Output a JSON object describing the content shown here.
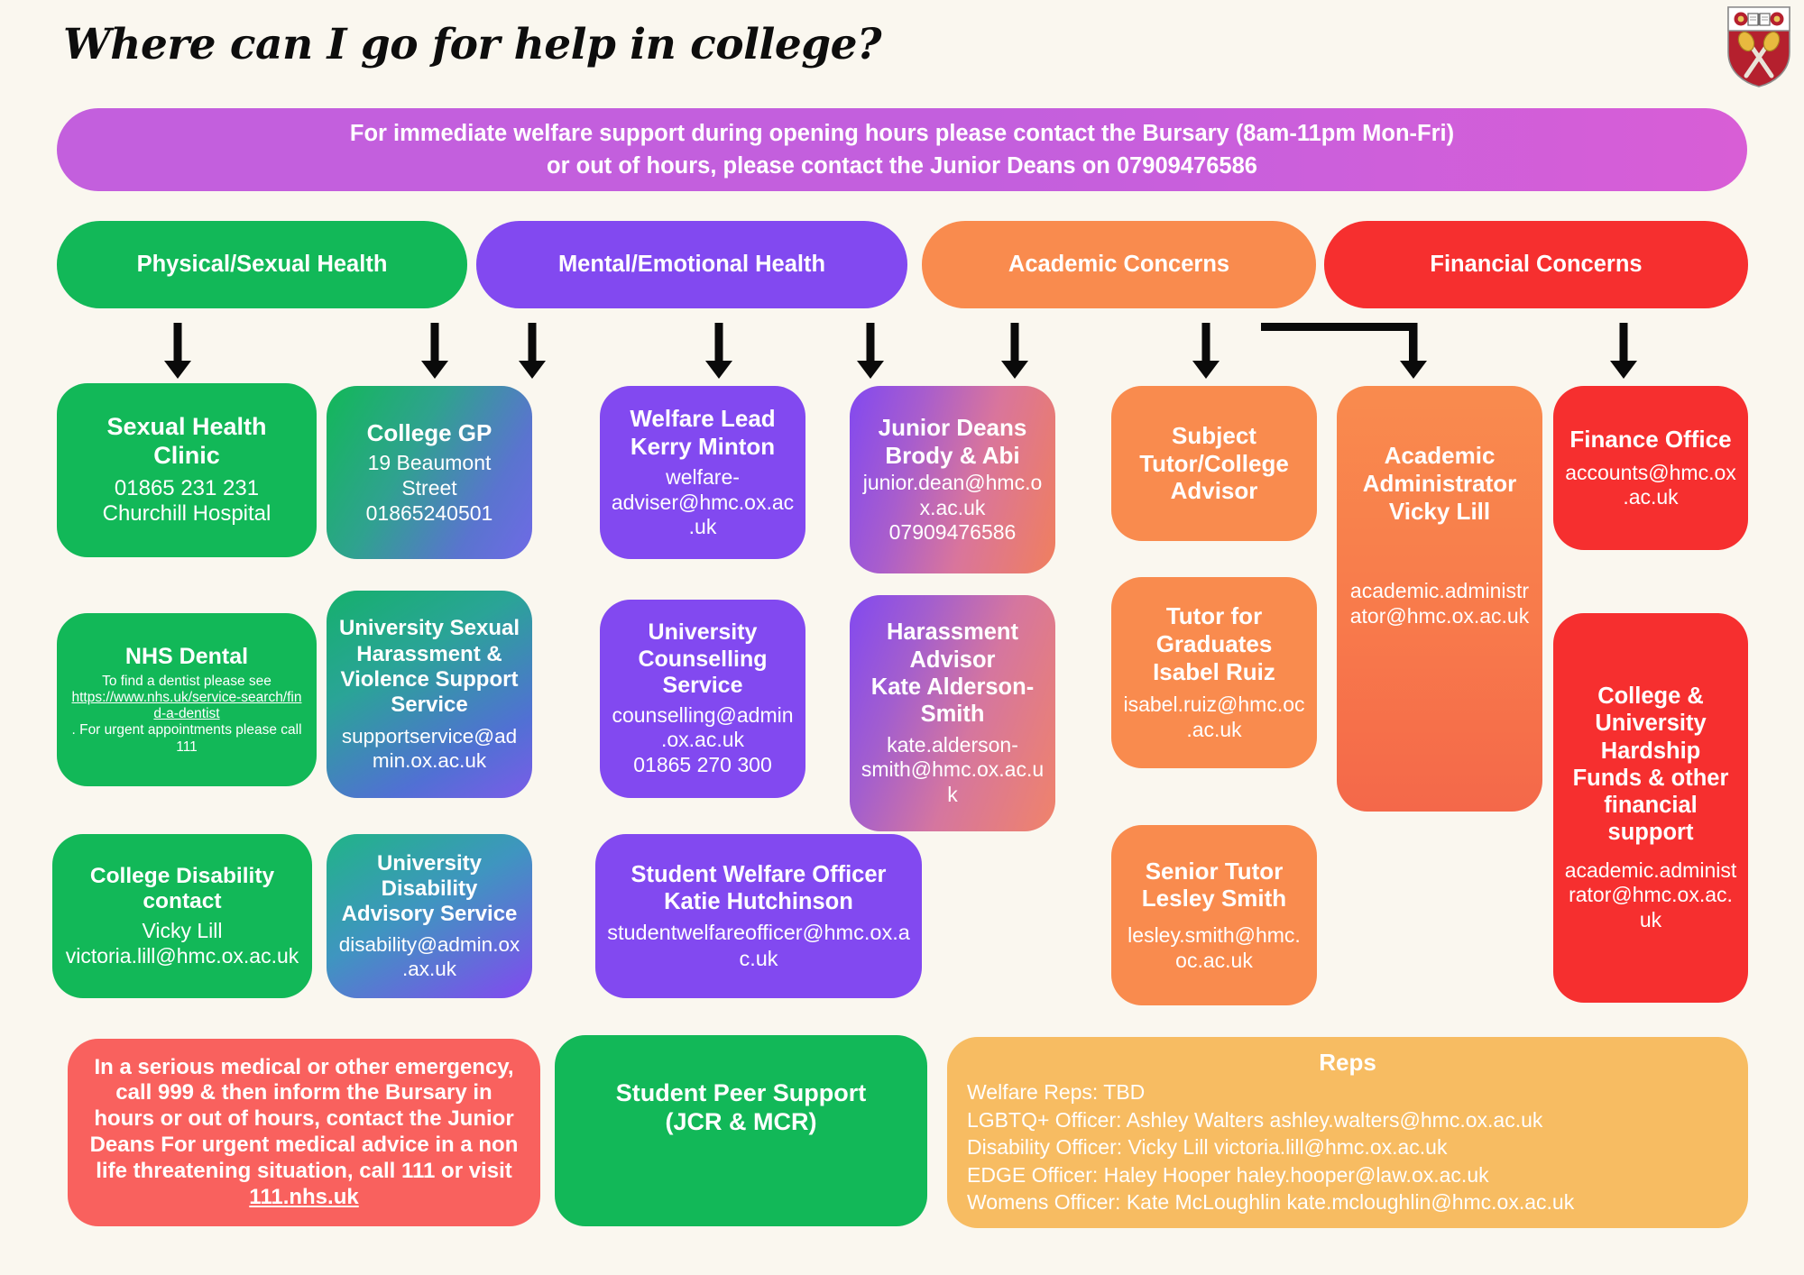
{
  "page": {
    "title": "Where can I go for help in college?",
    "background_color": "#faf7ef"
  },
  "crest": {
    "name": "college-coat-of-arms",
    "field_color": "#b5202e",
    "chief_color": "#ffffff",
    "charges": [
      "rose",
      "open-book",
      "rose",
      "crossed-maces"
    ]
  },
  "banner": {
    "line1": "For immediate welfare support during opening hours please contact the Bursary (8am-11pm Mon-Fri)",
    "line2": "or out of hours, please contact the Junior Deans on 07909476586",
    "color": "#c35fdd"
  },
  "categories": [
    {
      "label": "Physical/Sexual Health",
      "color": "#12b858"
    },
    {
      "label": "Mental/Emotional Health",
      "color": "#8249f0"
    },
    {
      "label": "Academic Concerns",
      "color": "#f98b4e"
    },
    {
      "label": "Financial Concerns",
      "color": "#f62f2f"
    }
  ],
  "cards": {
    "sexual_health_clinic": {
      "heading": "Sexual Health\nClinic",
      "body": "01865 231 231\nChurchill Hospital",
      "color": "#12b858"
    },
    "nhs_dental": {
      "heading": "NHS Dental",
      "body_pre": "To find a dentist please see",
      "link": "https://www.nhs.uk/service-search/find-a-dentist",
      "body_post": ". For urgent appointments please call 111",
      "color": "#12b858"
    },
    "college_disability": {
      "heading": "College Disability\ncontact",
      "body": "Vicky Lill\nvictoria.lill@hmc.ox.ac.uk",
      "color": "#12b858"
    },
    "college_gp": {
      "heading": "College GP",
      "body": "19 Beaumont Street\n01865240501",
      "color_from": "#12b858",
      "color_to": "#6f6ae6"
    },
    "university_sexual_harassment": {
      "heading": "University Sexual Harassment & Violence Support Service",
      "body": "supportservice@admin.ox.ac.uk",
      "color_from": "#15b06c",
      "color_to": "#7a5ce8"
    },
    "university_disability": {
      "heading": "University Disability Advisory Service",
      "body": "disability@admin.ox.ax.uk",
      "color_from": "#20b487",
      "color_to": "#8249f0"
    },
    "welfare_lead": {
      "heading": "Welfare Lead\nKerry Minton",
      "body": "welfare-adviser@hmc.ox.ac.uk",
      "color": "#8249f0"
    },
    "university_counselling": {
      "heading": "University Counselling Service",
      "body": "counselling@admin.ox.ac.uk\n01865 270 300",
      "color": "#8249f0"
    },
    "student_welfare_officer": {
      "heading": "Student Welfare Officer\nKatie Hutchinson",
      "body": "studentwelfareofficer@hmc.ox.ac.uk",
      "color": "#8249f0"
    },
    "junior_deans": {
      "heading": "Junior Deans\nBrody & Abi",
      "body": "junior.dean@hmc.ox.ac.uk\n07909476586",
      "color_from": "#8249f0",
      "color_to": "#f07f5e"
    },
    "harassment_advisor": {
      "heading": "Harassment Advisor\nKate Alderson-Smith",
      "body": "kate.alderson-smith@hmc.ox.ac.uk",
      "color_from": "#8249f0",
      "color_to": "#f0836a"
    },
    "subject_tutor": {
      "heading": "Subject Tutor/College Advisor",
      "color": "#f98b4e"
    },
    "tutor_for_graduates": {
      "heading": "Tutor for Graduates\nIsabel Ruiz",
      "body": "isabel.ruiz@hmc.oc.ac.uk",
      "color": "#f98b4e"
    },
    "senior_tutor": {
      "heading": "Senior Tutor\nLesley Smith",
      "body": "lesley.smith@hmc.oc.ac.uk",
      "color": "#f98b4e"
    },
    "academic_administrator": {
      "heading": "Academic Administrator\nVicky Lill",
      "body": "academic.administrator@hmc.ox.ac.uk",
      "color_from": "#f98b4e",
      "color_to": "#f4684a"
    },
    "finance_office": {
      "heading": "Finance Office",
      "body": "accounts@hmc.ox.ac.uk",
      "color": "#f62f2f"
    },
    "hardship_funds": {
      "heading": "College & University Hardship Funds & other financial support",
      "body": "academic.administrator@hmc.ox.ac.uk",
      "color": "#f62f2f"
    },
    "emergency": {
      "body_pre": "In a serious medical or other emergency, call 999 & then inform the Bursary in hours or out of hours, contact the Junior Deans For urgent medical advice in a non life threatening situation, call 111 or visit ",
      "link": "111.nhs.uk",
      "color": "#f9615e"
    },
    "peer_support": {
      "heading": "Student Peer Support\n(JCR & MCR)",
      "color": "#12b858"
    },
    "reps": {
      "heading": "Reps",
      "lines": [
        "Welfare Reps: TBD",
        "LGBTQ+ Officer: Ashley Walters ashley.walters@hmc.ox.ac.uk",
        "Disability Officer: Vicky Lill victoria.lill@hmc.ox.ac.uk",
        "EDGE Officer: Haley Hooper haley.hooper@law.ox.ac.uk",
        "Womens Officer: Kate McLoughlin kate.mcloughlin@hmc.ox.ac.uk"
      ],
      "color": "#f7bc62"
    }
  }
}
